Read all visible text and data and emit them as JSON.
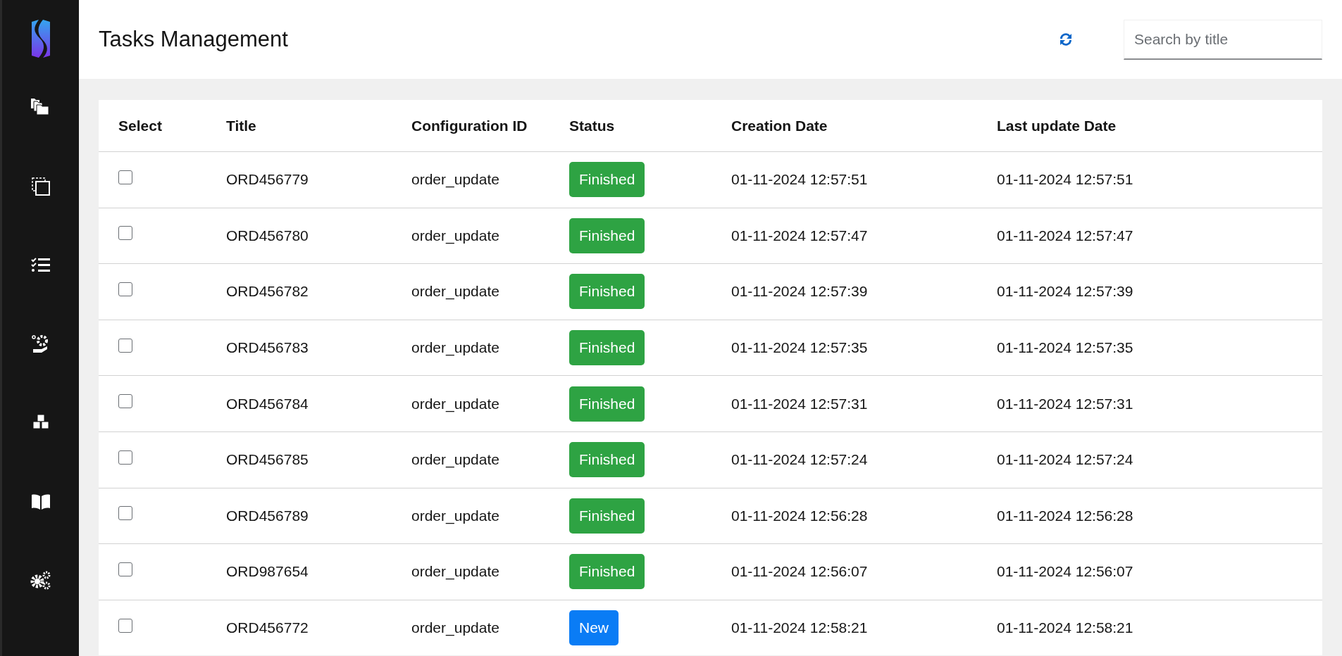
{
  "header": {
    "title": "Tasks Management",
    "search": {
      "placeholder": "Search by title"
    }
  },
  "table": {
    "columns": [
      "Select",
      "Title",
      "Configuration ID",
      "Status",
      "Creation Date",
      "Last update Date"
    ],
    "rows": [
      {
        "checked": false,
        "title": "ORD456779",
        "config": "order_update",
        "status": {
          "label": "Finished",
          "kind": "finished"
        },
        "created": "01-11-2024 12:57:51",
        "updated": "01-11-2024 12:57:51"
      },
      {
        "checked": false,
        "title": "ORD456780",
        "config": "order_update",
        "status": {
          "label": "Finished",
          "kind": "finished"
        },
        "created": "01-11-2024 12:57:47",
        "updated": "01-11-2024 12:57:47"
      },
      {
        "checked": false,
        "title": "ORD456782",
        "config": "order_update",
        "status": {
          "label": "Finished",
          "kind": "finished"
        },
        "created": "01-11-2024 12:57:39",
        "updated": "01-11-2024 12:57:39"
      },
      {
        "checked": false,
        "title": "ORD456783",
        "config": "order_update",
        "status": {
          "label": "Finished",
          "kind": "finished"
        },
        "created": "01-11-2024 12:57:35",
        "updated": "01-11-2024 12:57:35"
      },
      {
        "checked": false,
        "title": "ORD456784",
        "config": "order_update",
        "status": {
          "label": "Finished",
          "kind": "finished"
        },
        "created": "01-11-2024 12:57:31",
        "updated": "01-11-2024 12:57:31"
      },
      {
        "checked": false,
        "title": "ORD456785",
        "config": "order_update",
        "status": {
          "label": "Finished",
          "kind": "finished"
        },
        "created": "01-11-2024 12:57:24",
        "updated": "01-11-2024 12:57:24"
      },
      {
        "checked": false,
        "title": "ORD456789",
        "config": "order_update",
        "status": {
          "label": "Finished",
          "kind": "finished"
        },
        "created": "01-11-2024 12:56:28",
        "updated": "01-11-2024 12:56:28"
      },
      {
        "checked": false,
        "title": "ORD987654",
        "config": "order_update",
        "status": {
          "label": "Finished",
          "kind": "finished"
        },
        "created": "01-11-2024 12:56:07",
        "updated": "01-11-2024 12:56:07"
      },
      {
        "checked": false,
        "title": "ORD456772",
        "config": "order_update",
        "status": {
          "label": "New",
          "kind": "new"
        },
        "created": "01-11-2024 12:58:21",
        "updated": "01-11-2024 12:58:21"
      }
    ]
  }
}
